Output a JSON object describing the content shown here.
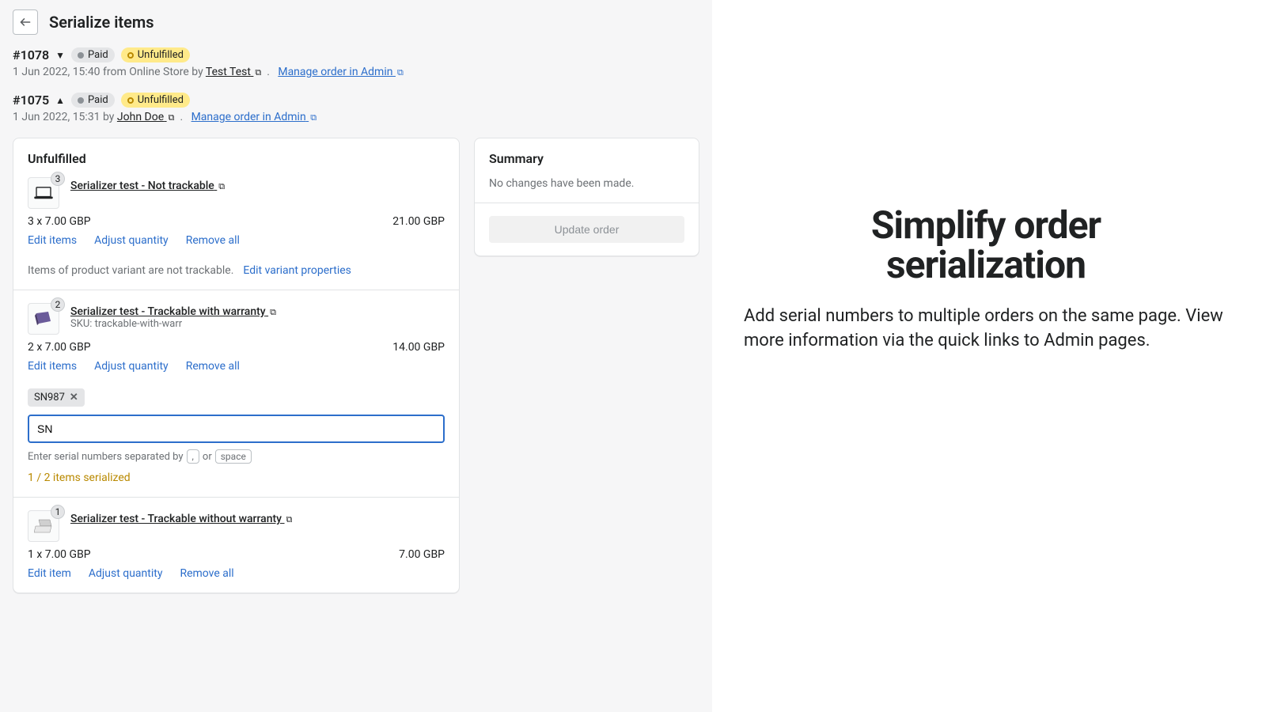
{
  "page": {
    "title": "Serialize items"
  },
  "orders": [
    {
      "number": "#1078",
      "expanded": false,
      "badges": {
        "paid": "Paid",
        "unfulfilled": "Unfulfilled"
      },
      "meta": {
        "prefix": "1 Jun 2022, 15:40 from Online Store by ",
        "author": "Test Test",
        "dot": ".",
        "manage": "Manage order in Admin"
      }
    },
    {
      "number": "#1075",
      "expanded": true,
      "badges": {
        "paid": "Paid",
        "unfulfilled": "Unfulfilled"
      },
      "meta": {
        "prefix": "1 Jun 2022, 15:31 by ",
        "author": "John Doe",
        "dot": ".",
        "manage": "Manage order in Admin"
      }
    }
  ],
  "unfulfilled": {
    "title": "Unfulfilled",
    "items": [
      {
        "qty_badge": "3",
        "name": "Serializer test - Not trackable",
        "price_left": "3 x 7.00 GBP",
        "price_right": "21.00 GBP",
        "actions": {
          "edit": "Edit items",
          "adjust": "Adjust quantity",
          "remove": "Remove all"
        },
        "note": "Items of product variant are not trackable.",
        "note_action": "Edit variant properties"
      },
      {
        "qty_badge": "2",
        "name": "Serializer test - Trackable with warranty",
        "sku": "SKU: trackable-with-warr",
        "price_left": "2 x 7.00 GBP",
        "price_right": "14.00 GBP",
        "actions": {
          "edit": "Edit items",
          "adjust": "Adjust quantity",
          "remove": "Remove all"
        },
        "tags": [
          "SN987"
        ],
        "input_value": "SN",
        "hint_prefix": "Enter serial numbers separated by",
        "key1": ",",
        "hint_or": "or",
        "key2": "space",
        "serialized": "1 / 2 items serialized"
      },
      {
        "qty_badge": "1",
        "name": "Serializer test - Trackable without warranty",
        "price_left": "1 x 7.00 GBP",
        "price_right": "7.00 GBP",
        "actions": {
          "edit": "Edit item",
          "adjust": "Adjust quantity",
          "remove": "Remove all"
        }
      }
    ]
  },
  "summary": {
    "title": "Summary",
    "text": "No changes have been made.",
    "button": "Update order"
  },
  "promo": {
    "title_l1": "Simplify order",
    "title_l2": "serialization",
    "desc": "Add serial numbers to multiple orders on the same page. View more information via the quick links to Admin pages."
  }
}
